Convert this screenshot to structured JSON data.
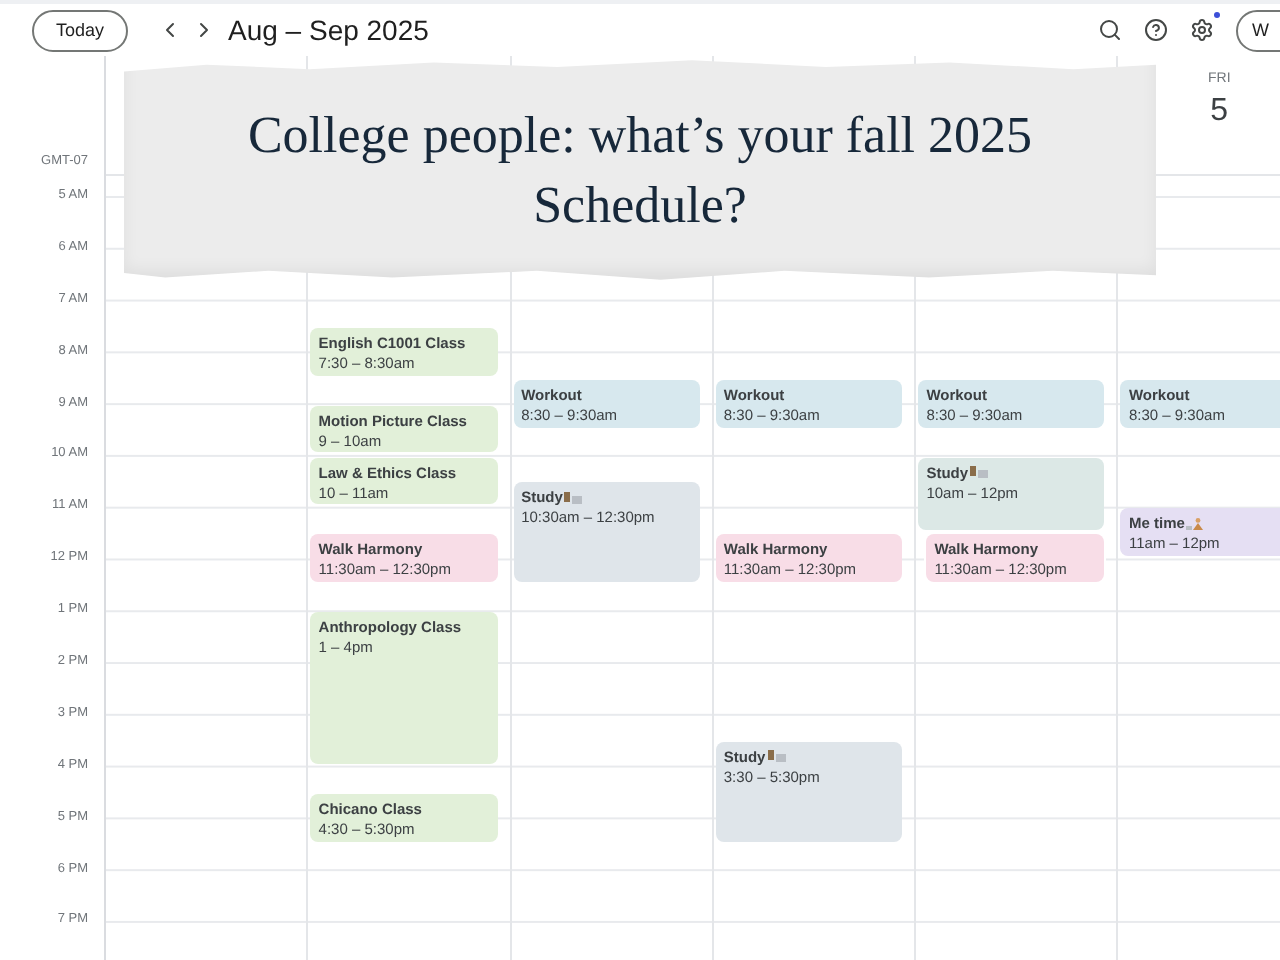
{
  "toolbar": {
    "today_button": "Today",
    "title": "Aug – Sep 2025",
    "view_button": "W"
  },
  "timezone": "GMT-07",
  "hours": [
    "5 AM",
    "6 AM",
    "7 AM",
    "8 AM",
    "9 AM",
    "10 AM",
    "11 AM",
    "12 PM",
    "1 PM",
    "2 PM",
    "3 PM",
    "4 PM",
    "5 PM",
    "6 PM",
    "7 PM"
  ],
  "days": [
    {
      "events": [
        {
          "title": "English C1001 Class",
          "time": "7:30 – 8:30am",
          "color": "#e2f0d9",
          "kind": "plain"
        },
        {
          "title": "Motion Picture Class",
          "time": "9 – 10am",
          "color": "#e2f0d9",
          "kind": "plain"
        },
        {
          "title": "Law & Ethics Class",
          "time": "10 – 11am",
          "color": "#e2f0d9",
          "kind": "plain"
        },
        {
          "title": "Walk Harmony",
          "time": "11:30am – 12:30pm",
          "color": "#f8dde7",
          "kind": "plain"
        },
        {
          "title": "Anthropology Class",
          "time": "1 – 4pm",
          "color": "#e2f0d9",
          "kind": "plain"
        },
        {
          "title": "Chicano Class",
          "time": "4:30 – 5:30pm",
          "color": "#e2f0d9",
          "kind": "plain"
        }
      ]
    },
    {
      "events": [
        {
          "title": "Workout",
          "time": "8:30 – 9:30am",
          "color": "#d7e8ee",
          "kind": "plain"
        },
        {
          "title": "Study",
          "time": "10:30am – 12:30pm",
          "color": "#dfe5ea",
          "kind": "study"
        }
      ]
    },
    {
      "events": [
        {
          "title": "Workout",
          "time": "8:30 – 9:30am",
          "color": "#d7e8ee",
          "kind": "plain"
        },
        {
          "title": "Walk Harmony",
          "time": "11:30am – 12:30pm",
          "color": "#f8dde7",
          "kind": "plain"
        },
        {
          "title": "Study",
          "time": "3:30 – 5:30pm",
          "color": "#dfe5ea",
          "kind": "study"
        }
      ]
    },
    {
      "events": [
        {
          "title": "Workout",
          "time": "8:30 – 9:30am",
          "color": "#d7e8ee",
          "kind": "plain"
        },
        {
          "title": "Study",
          "time": "10am – 12pm",
          "color": "#dce8e6",
          "kind": "study"
        },
        {
          "title": "Walk Harmony",
          "time": "11:30am – 12:30pm",
          "color": "#f8dde7",
          "kind": "plain"
        }
      ]
    },
    {
      "header": {
        "weekday": "FRI",
        "date": "5"
      },
      "events": [
        {
          "title": "Workout",
          "time": "8:30 – 9:30am",
          "color": "#d7e8ee",
          "kind": "plain"
        },
        {
          "title": "Me time",
          "time": "11am – 12pm",
          "color": "#e5dff3",
          "kind": "relax"
        }
      ]
    }
  ],
  "overlay": {
    "title": "College people: what’s your fall 2025 Schedule?"
  }
}
